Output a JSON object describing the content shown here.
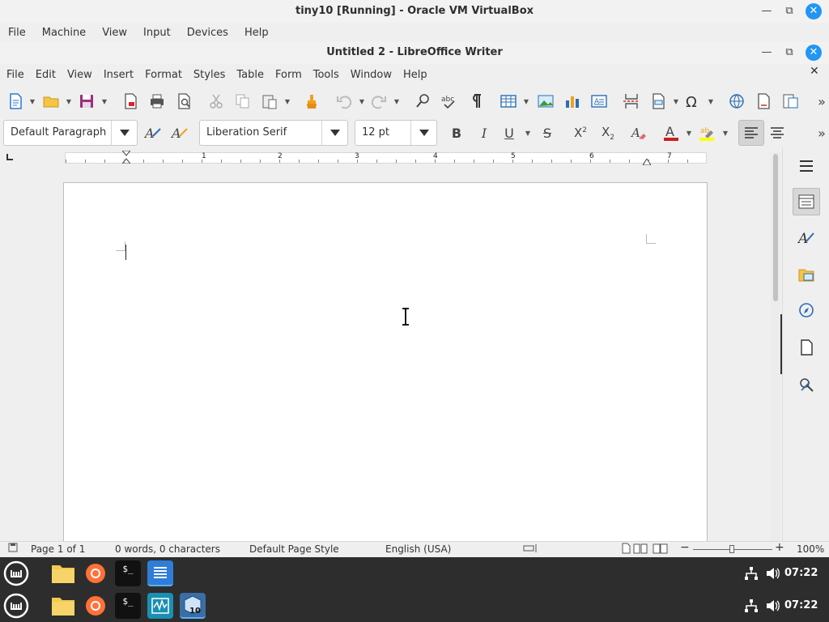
{
  "vbox": {
    "title": "tiny10 [Running] - Oracle VM VirtualBox",
    "menu": [
      "File",
      "Machine",
      "View",
      "Input",
      "Devices",
      "Help"
    ]
  },
  "writer": {
    "title": "Untitled 2 - LibreOffice Writer",
    "menu": [
      "File",
      "Edit",
      "View",
      "Insert",
      "Format",
      "Styles",
      "Table",
      "Form",
      "Tools",
      "Window",
      "Help"
    ],
    "paragraph_style": "Default Paragraph",
    "font_name": "Liberation Serif",
    "font_size": "12 pt",
    "colors": {
      "accent": "#2196f3",
      "font_color": "#c9211e",
      "highlight": "#ffff00"
    }
  },
  "status": {
    "page": "Page 1 of 1",
    "words": "0 words, 0 characters",
    "page_style": "Default Page Style",
    "language": "English (USA)",
    "zoom": "100%"
  },
  "ruler": {
    "marks": [
      "1",
      "2",
      "3",
      "4",
      "5",
      "6",
      "7"
    ]
  },
  "taskbar": {
    "clock": "07:22"
  }
}
